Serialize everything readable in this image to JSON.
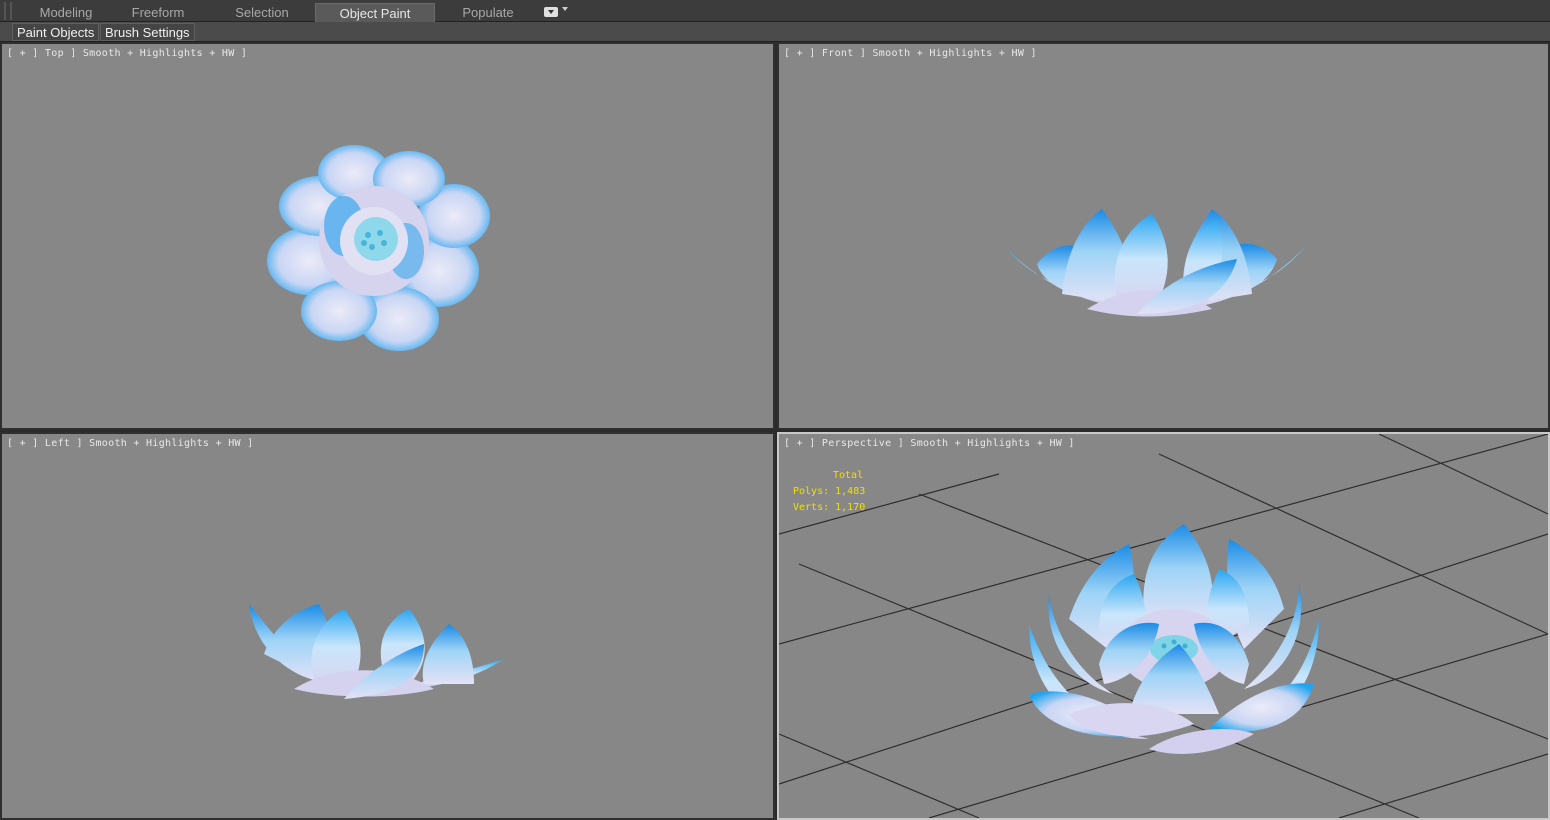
{
  "ribbon": {
    "tabs": [
      {
        "label": "Modeling",
        "active": false
      },
      {
        "label": "Freeform",
        "active": false
      },
      {
        "label": "Selection",
        "active": false
      },
      {
        "label": "Object Paint",
        "active": true
      },
      {
        "label": "Populate",
        "active": false
      }
    ],
    "menu_icon": "ribbon-dropdown-icon"
  },
  "subbar": {
    "paint_objects": "Paint Objects",
    "brush_settings": "Brush Settings"
  },
  "viewports": {
    "top": {
      "label": "[ + ] Top ] Smooth + Highlights + HW ]"
    },
    "front": {
      "label": "[ + ] Front ] Smooth + Highlights + HW ]"
    },
    "left": {
      "label": "[ + ] Left ] Smooth + Highlights + HW ]"
    },
    "perspective": {
      "label": "[ + ] Perspective ] Smooth + Highlights + HW ]"
    }
  },
  "stats": {
    "total": "Total",
    "polys": "Polys: 1,483",
    "verts": "Verts: 1,170"
  },
  "colors": {
    "viewport_bg": "#878787",
    "petal_edge": "#1e8fe8",
    "petal_body": "#d8d8f2",
    "stats_text": "#f0e000"
  }
}
